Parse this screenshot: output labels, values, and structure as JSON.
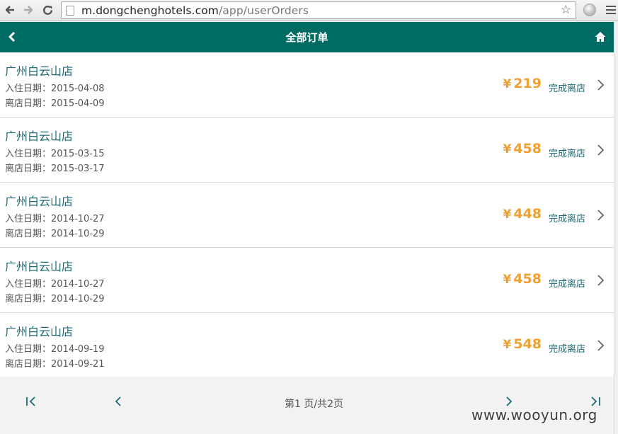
{
  "browser": {
    "url_host": "m.dongchenghotels.com",
    "url_path": "/app/userOrders"
  },
  "header": {
    "title": "全部订单"
  },
  "orders": [
    {
      "hotel": "广州白云山店",
      "checkin": "入住日期：2015-04-08",
      "checkout": "离店日期：2015-04-09",
      "currency": "¥",
      "price": "219",
      "status": "完成离店"
    },
    {
      "hotel": "广州白云山店",
      "checkin": "入住日期：2015-03-15",
      "checkout": "离店日期：2015-03-17",
      "currency": "¥",
      "price": "458",
      "status": "完成离店"
    },
    {
      "hotel": "广州白云山店",
      "checkin": "入住日期：2014-10-27",
      "checkout": "离店日期：2014-10-29",
      "currency": "¥",
      "price": "448",
      "status": "完成离店"
    },
    {
      "hotel": "广州白云山店",
      "checkin": "入住日期：2014-10-27",
      "checkout": "离店日期：2014-10-29",
      "currency": "¥",
      "price": "458",
      "status": "完成离店"
    },
    {
      "hotel": "广州白云山店",
      "checkin": "入住日期：2014-09-19",
      "checkout": "离店日期：2014-09-21",
      "currency": "¥",
      "price": "548",
      "status": "完成离店"
    }
  ],
  "pager": {
    "text": "第1 页/共2页"
  },
  "watermark": "www.wooyun.org",
  "colors": {
    "header_bg": "#006b63",
    "price": "#f0a030",
    "link_text": "#1c6a73"
  },
  "icons": {
    "back": "chevron-left-icon",
    "home": "home-icon",
    "row_arrow": "chevron-right-icon",
    "first": "first-page-icon",
    "prev": "chevron-left-icon",
    "next": "chevron-right-icon",
    "last": "last-page-icon"
  }
}
